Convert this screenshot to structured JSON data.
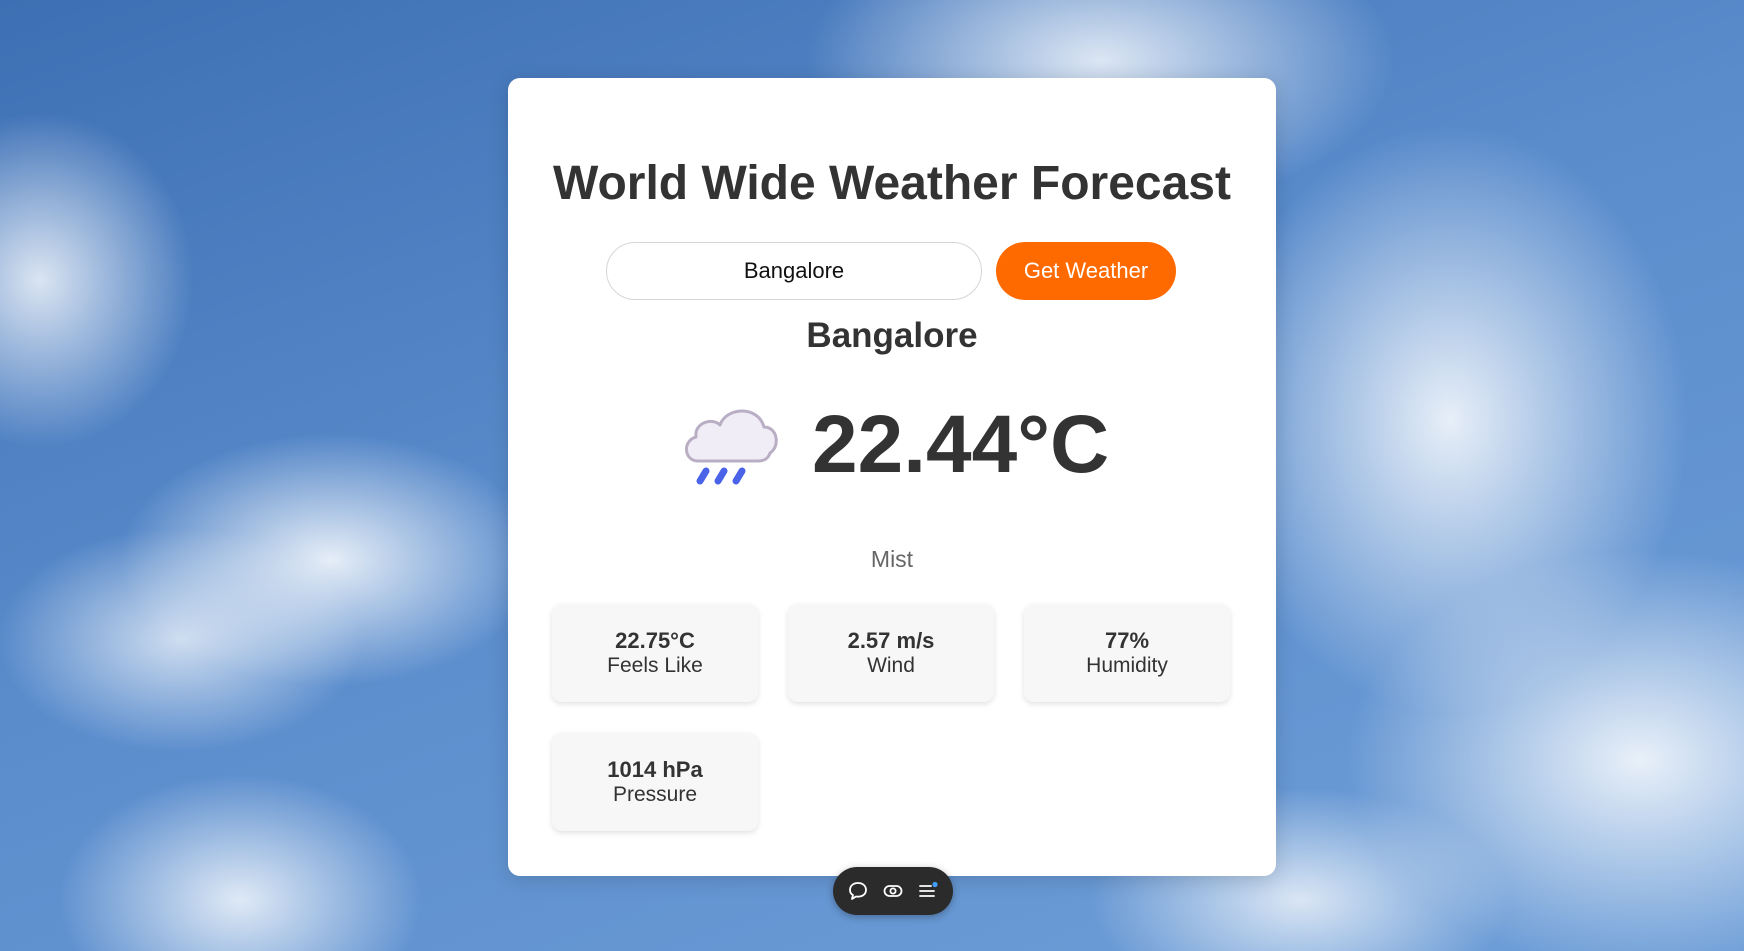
{
  "app": {
    "title": "World Wide Weather Forecast"
  },
  "search": {
    "value": "Bangalore",
    "button_label": "Get Weather"
  },
  "weather": {
    "city": "Bangalore",
    "temperature": "22.44°C",
    "condition": "Mist",
    "icon": "rain-cloud-icon"
  },
  "stats": [
    {
      "value": "22.75°C",
      "label": "Feels Like"
    },
    {
      "value": "2.57 m/s",
      "label": "Wind"
    },
    {
      "value": "77%",
      "label": "Humidity"
    },
    {
      "value": "1014 hPa",
      "label": "Pressure"
    }
  ],
  "toolbar": {
    "icons": [
      "comment-icon",
      "eye-icon",
      "menu-icon"
    ]
  },
  "colors": {
    "accent": "#ff6a00",
    "text": "#333333",
    "rain": "#4a63e8"
  }
}
